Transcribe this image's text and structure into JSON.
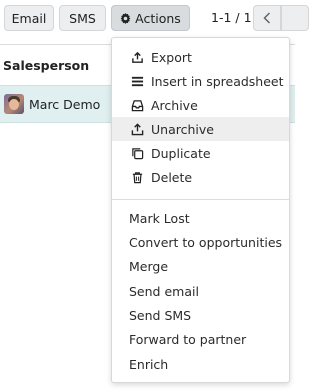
{
  "toolbar": {
    "email_label": "Email",
    "sms_label": "SMS",
    "actions_label": "Actions",
    "pager_value": "1-1 / 1"
  },
  "list": {
    "columns": [
      "Salesperson"
    ],
    "rows": [
      {
        "salesperson": "Marc Demo",
        "selected": true
      }
    ]
  },
  "actions_menu": {
    "groups": [
      [
        {
          "label": "Export",
          "icon": "upload-icon"
        },
        {
          "label": "Insert in spreadsheet",
          "icon": "list-icon"
        },
        {
          "label": "Archive",
          "icon": "archive-icon"
        },
        {
          "label": "Unarchive",
          "icon": "unarchive-icon",
          "hovered": true
        },
        {
          "label": "Duplicate",
          "icon": "copy-icon"
        },
        {
          "label": "Delete",
          "icon": "trash-icon"
        }
      ],
      [
        {
          "label": "Mark Lost"
        },
        {
          "label": "Convert to opportunities"
        },
        {
          "label": "Merge"
        },
        {
          "label": "Send email"
        },
        {
          "label": "Send SMS"
        },
        {
          "label": "Forward to partner"
        },
        {
          "label": "Enrich"
        }
      ]
    ]
  }
}
